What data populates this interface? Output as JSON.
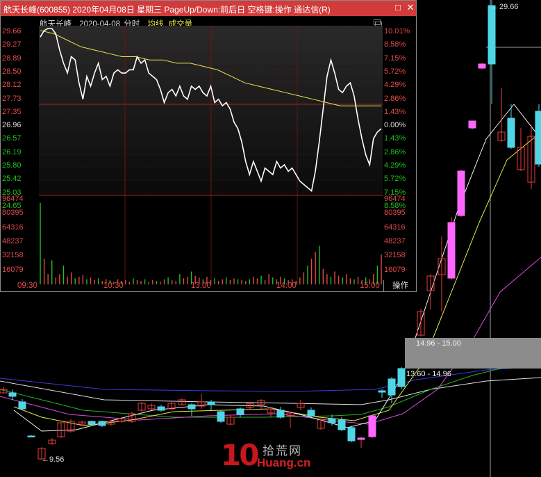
{
  "popup": {
    "title": "航天长峰(600855) 2020年04月08日 星期三 PageUp/Down:前后日 空格键:操作 通达信(R)",
    "subhead": {
      "stock": "航天长峰",
      "date": "2020-04-08",
      "mode": "分时",
      "avg_label": "均线",
      "vol_label": "成交量"
    },
    "price_labels": [
      "29.66",
      "29.27",
      "28.89",
      "28.50",
      "28.12",
      "27.73",
      "27.35",
      "26.96",
      "26.57",
      "26.19",
      "25.80",
      "25.42",
      "25.03",
      "24.65"
    ],
    "pct_labels": [
      "10.01%",
      "8.58%",
      "7.15%",
      "5.72%",
      "4.29%",
      "2.86%",
      "1.43%",
      "0.00%",
      "1.43%",
      "2.86%",
      "4.29%",
      "5.72%",
      "7.15%",
      "8.58%"
    ],
    "volume_labels": [
      "96474",
      "80395",
      "64316",
      "48237",
      "32158",
      "16079"
    ],
    "time_labels": [
      "09:30",
      "10:30",
      "13:00",
      "14:00",
      "15:00"
    ],
    "op_button": "操作",
    "colors": {
      "up": "#e24a4a",
      "down": "#20c020",
      "neutral": "#dddddd",
      "title_bg": "#d23b3b",
      "avg": "#e8e84a"
    }
  },
  "background_chart": {
    "high_tag": "29.66",
    "low_tag": "9.56",
    "band_upper": "14.96 - 15.00",
    "band_lower": "13.60 - 14.96"
  },
  "watermark": {
    "number": "10",
    "cn": "拾荒网",
    "en": "Huang.cn"
  },
  "chart_data": [
    {
      "type": "line",
      "title": "航天长峰 2020-04-08 分时",
      "x_ticks": [
        "09:30",
        "10:30",
        "13:00",
        "14:00",
        "15:00"
      ],
      "ylim": [
        24.65,
        29.66
      ],
      "prev_close": 26.96,
      "series": [
        {
          "name": "价格",
          "values": [
            29.4,
            29.6,
            29.66,
            29.66,
            29.5,
            29.0,
            28.6,
            28.3,
            28.8,
            28.7,
            28.0,
            27.5,
            28.2,
            27.9,
            28.3,
            28.6,
            28.1,
            28.2,
            27.9,
            28.3,
            28.4,
            28.3,
            28.3,
            28.4,
            28.4,
            28.8,
            28.6,
            28.7,
            28.3,
            28.2,
            28.1,
            27.8,
            27.4,
            27.7,
            27.8,
            27.6,
            27.9,
            27.6,
            27.5,
            27.9,
            27.8,
            27.9,
            27.7,
            27.6,
            27.9,
            27.4,
            27.5,
            27.3,
            27.4,
            27.2,
            26.8,
            26.6,
            26.2,
            25.6,
            25.2,
            25.6,
            25.3,
            25.0,
            25.4,
            25.3,
            25.2,
            25.6,
            25.4,
            25.5,
            25.3,
            25.4,
            25.2,
            25.0,
            24.9,
            24.8,
            24.7,
            25.3,
            26.2,
            27.2,
            28.2,
            28.7,
            28.3,
            27.8,
            27.7,
            27.9,
            28.0,
            27.6,
            26.9,
            26.3,
            25.8,
            25.5,
            26.3,
            26.5,
            26.6
          ]
        },
        {
          "name": "均价",
          "values": [
            29.6,
            29.5,
            29.3,
            29.1,
            29.0,
            28.9,
            28.8,
            28.8,
            28.7,
            28.7,
            28.6,
            28.6,
            28.5,
            28.4,
            28.2,
            28.0,
            27.9,
            27.8,
            27.7,
            27.6,
            27.5,
            27.4,
            27.3,
            27.3,
            27.3,
            27.3
          ]
        }
      ]
    },
    {
      "type": "bar",
      "title": "成交量",
      "ylim": [
        0,
        96474
      ],
      "values": [
        95000,
        30000,
        12000,
        28000,
        8000,
        12000,
        22000,
        9000,
        14000,
        7000,
        9000,
        11000,
        6000,
        8000,
        5000,
        7000,
        4000,
        6000,
        5000,
        3000,
        6000,
        4000,
        5000,
        3000,
        7000,
        5000,
        4000,
        6000,
        3000,
        5000,
        4000,
        3000,
        6000,
        8000,
        5000,
        4000,
        12000,
        7000,
        9000,
        15000,
        10000,
        8000,
        6000,
        9000,
        5000,
        7000,
        4000,
        6000,
        8000,
        5000,
        7000,
        6000,
        5000,
        4000,
        6000,
        9000,
        7000,
        10000,
        5000,
        12000,
        8000,
        6000,
        9000,
        7000,
        5000,
        6000,
        4000,
        8000,
        14000,
        22000,
        30000,
        38000,
        45000,
        18000,
        12000,
        9000,
        15000,
        10000,
        8000,
        12000,
        7000,
        6000,
        9000,
        5000,
        8000,
        6000,
        12000,
        22000,
        35000
      ]
    },
    {
      "type": "candlestick",
      "title": "日K线",
      "markers": {
        "high": 29.66,
        "low": 9.56
      }
    }
  ]
}
